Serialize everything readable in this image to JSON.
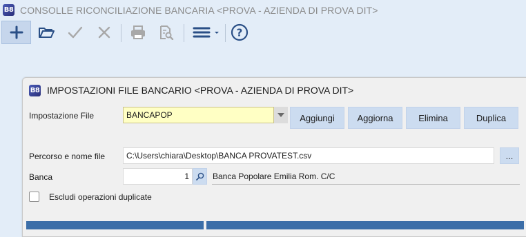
{
  "app": {
    "logo_text": "B8",
    "title": "CONSOLLE RICONCILIAZIONE BANCARIA <PROVA - AZIENDA DI PROVA DIT>"
  },
  "toolbar": {
    "buttons": [
      {
        "name": "new",
        "icon": "plus-icon",
        "state": "active"
      },
      {
        "name": "open",
        "icon": "folder-icon",
        "state": "enabled"
      },
      {
        "name": "confirm",
        "icon": "checkmark-icon",
        "state": "disabled"
      },
      {
        "name": "cancel",
        "icon": "close-icon",
        "state": "disabled"
      },
      {
        "name": "print",
        "icon": "printer-icon",
        "state": "disabled"
      },
      {
        "name": "print-preview",
        "icon": "print-preview-icon",
        "state": "disabled"
      },
      {
        "name": "menu",
        "icon": "hamburger-menu-icon",
        "state": "enabled"
      },
      {
        "name": "help",
        "icon": "help-icon",
        "state": "enabled"
      }
    ]
  },
  "dialog": {
    "logo_text": "B8",
    "title": "IMPOSTAZIONI FILE BANCARIO <PROVA - AZIENDA DI PROVA DIT>",
    "setting_label": "Impostazione File",
    "setting_value": "BANCAPOP",
    "buttons": {
      "add": "Aggiungi",
      "update": "Aggiorna",
      "delete": "Elimina",
      "duplicate": "Duplica"
    },
    "path_label": "Percorso e nome file",
    "path_value": "C:\\Users\\chiara\\Desktop\\BANCA PROVATEST.csv",
    "browse_label": "...",
    "bank_label": "Banca",
    "bank_code": "1",
    "bank_description": "Banca Popolare Emilia Rom. C/C",
    "exclude_duplicates_label": "Escludi operazioni duplicate",
    "exclude_duplicates_checked": false
  },
  "colors": {
    "background": "#e3edf8",
    "accent": "#2a4f86",
    "button": "#ccdcf0",
    "combo_highlight": "#ffffc4"
  }
}
